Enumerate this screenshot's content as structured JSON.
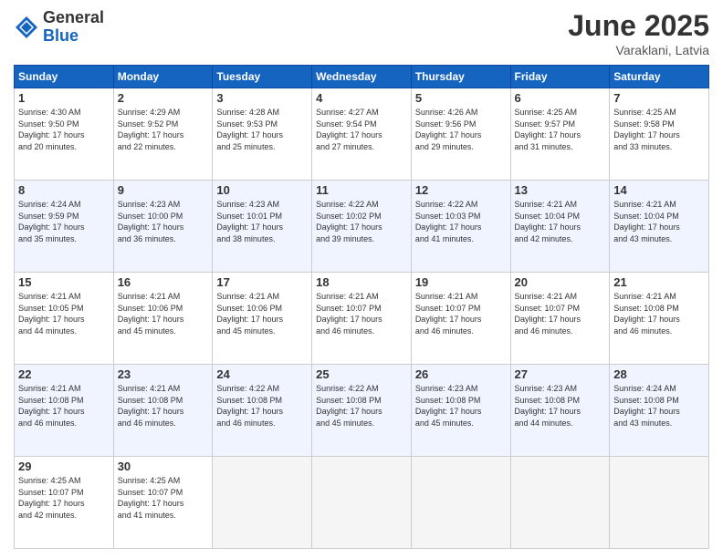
{
  "header": {
    "logo_general": "General",
    "logo_blue": "Blue",
    "month": "June 2025",
    "location": "Varaklani, Latvia"
  },
  "weekdays": [
    "Sunday",
    "Monday",
    "Tuesday",
    "Wednesday",
    "Thursday",
    "Friday",
    "Saturday"
  ],
  "weeks": [
    [
      {
        "day": 1,
        "info": "Sunrise: 4:30 AM\nSunset: 9:50 PM\nDaylight: 17 hours\nand 20 minutes."
      },
      {
        "day": 2,
        "info": "Sunrise: 4:29 AM\nSunset: 9:52 PM\nDaylight: 17 hours\nand 22 minutes."
      },
      {
        "day": 3,
        "info": "Sunrise: 4:28 AM\nSunset: 9:53 PM\nDaylight: 17 hours\nand 25 minutes."
      },
      {
        "day": 4,
        "info": "Sunrise: 4:27 AM\nSunset: 9:54 PM\nDaylight: 17 hours\nand 27 minutes."
      },
      {
        "day": 5,
        "info": "Sunrise: 4:26 AM\nSunset: 9:56 PM\nDaylight: 17 hours\nand 29 minutes."
      },
      {
        "day": 6,
        "info": "Sunrise: 4:25 AM\nSunset: 9:57 PM\nDaylight: 17 hours\nand 31 minutes."
      },
      {
        "day": 7,
        "info": "Sunrise: 4:25 AM\nSunset: 9:58 PM\nDaylight: 17 hours\nand 33 minutes."
      }
    ],
    [
      {
        "day": 8,
        "info": "Sunrise: 4:24 AM\nSunset: 9:59 PM\nDaylight: 17 hours\nand 35 minutes."
      },
      {
        "day": 9,
        "info": "Sunrise: 4:23 AM\nSunset: 10:00 PM\nDaylight: 17 hours\nand 36 minutes."
      },
      {
        "day": 10,
        "info": "Sunrise: 4:23 AM\nSunset: 10:01 PM\nDaylight: 17 hours\nand 38 minutes."
      },
      {
        "day": 11,
        "info": "Sunrise: 4:22 AM\nSunset: 10:02 PM\nDaylight: 17 hours\nand 39 minutes."
      },
      {
        "day": 12,
        "info": "Sunrise: 4:22 AM\nSunset: 10:03 PM\nDaylight: 17 hours\nand 41 minutes."
      },
      {
        "day": 13,
        "info": "Sunrise: 4:21 AM\nSunset: 10:04 PM\nDaylight: 17 hours\nand 42 minutes."
      },
      {
        "day": 14,
        "info": "Sunrise: 4:21 AM\nSunset: 10:04 PM\nDaylight: 17 hours\nand 43 minutes."
      }
    ],
    [
      {
        "day": 15,
        "info": "Sunrise: 4:21 AM\nSunset: 10:05 PM\nDaylight: 17 hours\nand 44 minutes."
      },
      {
        "day": 16,
        "info": "Sunrise: 4:21 AM\nSunset: 10:06 PM\nDaylight: 17 hours\nand 45 minutes."
      },
      {
        "day": 17,
        "info": "Sunrise: 4:21 AM\nSunset: 10:06 PM\nDaylight: 17 hours\nand 45 minutes."
      },
      {
        "day": 18,
        "info": "Sunrise: 4:21 AM\nSunset: 10:07 PM\nDaylight: 17 hours\nand 46 minutes."
      },
      {
        "day": 19,
        "info": "Sunrise: 4:21 AM\nSunset: 10:07 PM\nDaylight: 17 hours\nand 46 minutes."
      },
      {
        "day": 20,
        "info": "Sunrise: 4:21 AM\nSunset: 10:07 PM\nDaylight: 17 hours\nand 46 minutes."
      },
      {
        "day": 21,
        "info": "Sunrise: 4:21 AM\nSunset: 10:08 PM\nDaylight: 17 hours\nand 46 minutes."
      }
    ],
    [
      {
        "day": 22,
        "info": "Sunrise: 4:21 AM\nSunset: 10:08 PM\nDaylight: 17 hours\nand 46 minutes."
      },
      {
        "day": 23,
        "info": "Sunrise: 4:21 AM\nSunset: 10:08 PM\nDaylight: 17 hours\nand 46 minutes."
      },
      {
        "day": 24,
        "info": "Sunrise: 4:22 AM\nSunset: 10:08 PM\nDaylight: 17 hours\nand 46 minutes."
      },
      {
        "day": 25,
        "info": "Sunrise: 4:22 AM\nSunset: 10:08 PM\nDaylight: 17 hours\nand 45 minutes."
      },
      {
        "day": 26,
        "info": "Sunrise: 4:23 AM\nSunset: 10:08 PM\nDaylight: 17 hours\nand 45 minutes."
      },
      {
        "day": 27,
        "info": "Sunrise: 4:23 AM\nSunset: 10:08 PM\nDaylight: 17 hours\nand 44 minutes."
      },
      {
        "day": 28,
        "info": "Sunrise: 4:24 AM\nSunset: 10:08 PM\nDaylight: 17 hours\nand 43 minutes."
      }
    ],
    [
      {
        "day": 29,
        "info": "Sunrise: 4:25 AM\nSunset: 10:07 PM\nDaylight: 17 hours\nand 42 minutes."
      },
      {
        "day": 30,
        "info": "Sunrise: 4:25 AM\nSunset: 10:07 PM\nDaylight: 17 hours\nand 41 minutes."
      },
      null,
      null,
      null,
      null,
      null
    ]
  ]
}
